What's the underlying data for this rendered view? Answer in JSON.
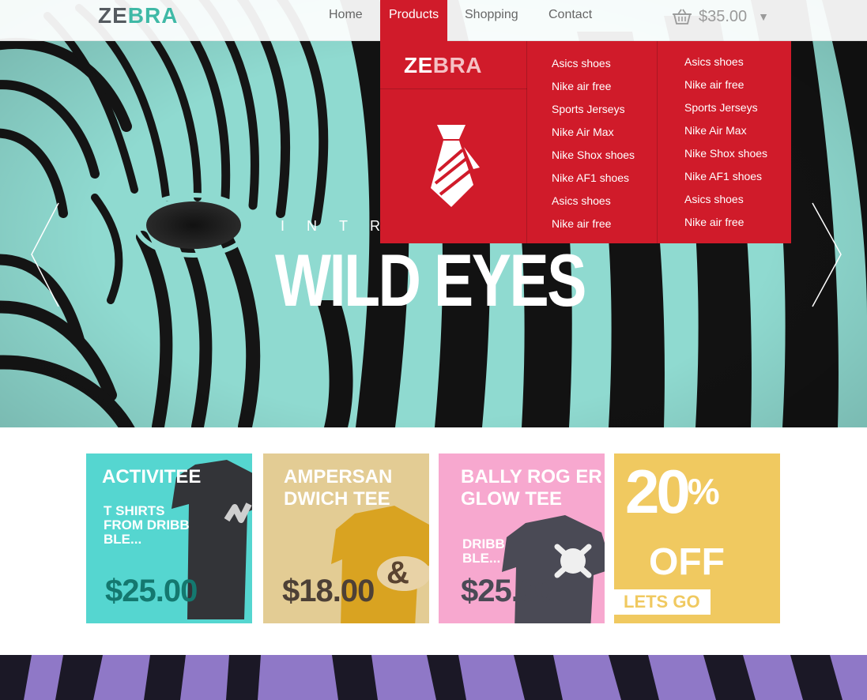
{
  "nav": {
    "logo_a": "ZE",
    "logo_b": "BRA",
    "items": [
      "Home",
      "Products",
      "Shopping",
      "Contact"
    ],
    "active": "Products",
    "cart_total": "$35.00",
    "cart_icon": "basket-icon",
    "caret_icon": "caret-down-icon"
  },
  "dropdown": {
    "logo_a": "ZE",
    "logo_b": "BRA",
    "icon": "tie-icon",
    "col1": [
      "Asics shoes",
      "Nike air free",
      "Sports Jerseys",
      "Nike Air Max",
      "Nike Shox shoes",
      "Nike AF1 shoes",
      "Asics shoes",
      "Nike air free"
    ],
    "col2": [
      "Asics shoes",
      "Nike air free",
      "Sports Jerseys",
      "Nike Air Max",
      "Nike Shox shoes",
      "Nike AF1 shoes",
      "Asics shoes",
      "Nike air free"
    ]
  },
  "hero": {
    "intro": "INTR",
    "title": "WILD EYES",
    "prev_icon": "chevron-left-icon",
    "next_icon": "chevron-right-icon"
  },
  "cards": [
    {
      "title": "ACTIVITEE",
      "sub": "T SHIRTS FROM DRIBB BLE...",
      "price": "$25.00"
    },
    {
      "title": "AMPERSAN DWICH TEE",
      "price": "$18.00"
    },
    {
      "title": "BALLY ROG ER GLOW TEE",
      "sub": "DRIBB BLE...",
      "price": "$25.00"
    },
    {
      "pct": "20",
      "pct_sign": "%",
      "off": "OFF",
      "cta": "LETS GO"
    }
  ],
  "colors": {
    "accent_red": "#d01b2a",
    "teal": "#3fb9a6",
    "hero_mint": "#8fdad0",
    "card_teal": "#55d6d0",
    "card_sand": "#e3cc94",
    "card_pink": "#f7a8cf",
    "card_yellow": "#f0c960",
    "strip_purple": "#8f78c7"
  }
}
